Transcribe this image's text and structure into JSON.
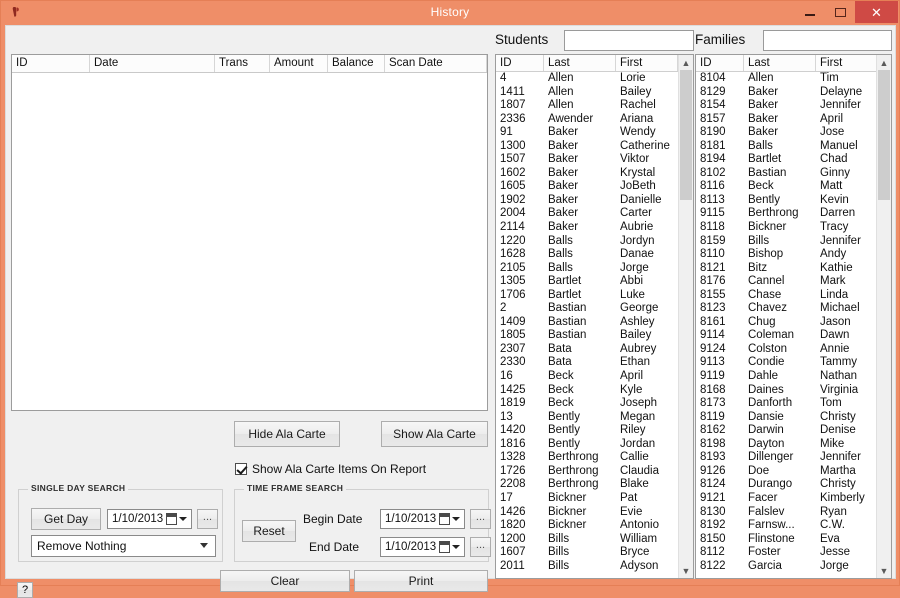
{
  "window": {
    "title": "History",
    "icon": "app-icon",
    "minimize_label": "–",
    "maximize_label": "□",
    "close_label": "✕",
    "border_color": "#ef8e68",
    "close_color": "#cf4a45"
  },
  "history_grid": {
    "columns": [
      "ID",
      "Date",
      "Trans",
      "Amount",
      "Balance",
      "Scan Date"
    ],
    "rows": []
  },
  "ala_carte": {
    "hide_label": "Hide Ala Carte",
    "show_label": "Show Ala Carte",
    "checkbox_label": "Show Ala Carte Items On Report",
    "checkbox_checked": true
  },
  "single_day_search": {
    "title": "SINGLE DAY SEARCH",
    "get_day_label": "Get Day",
    "date_value": "1/10/2013",
    "ellipsis_label": "...",
    "combo_value": "Remove Nothing"
  },
  "time_frame_search": {
    "title": "TIME FRAME SEARCH",
    "reset_label": "Reset",
    "begin_label": "Begin Date",
    "begin_value": "1/10/2013",
    "end_label": "End Date",
    "end_value": "1/10/2013",
    "ellipsis_label": "..."
  },
  "bottom_bar": {
    "clear_label": "Clear",
    "print_label": "Print",
    "help_label": "?"
  },
  "students": {
    "label": "Students",
    "search_value": "",
    "columns": [
      "ID",
      "Last",
      "First"
    ],
    "rows": [
      [
        "4",
        "Allen",
        "Lorie"
      ],
      [
        "1411",
        "Allen",
        "Bailey"
      ],
      [
        "1807",
        "Allen",
        "Rachel"
      ],
      [
        "2336",
        "Awender",
        "Ariana"
      ],
      [
        "91",
        "Baker",
        "Wendy"
      ],
      [
        "1300",
        "Baker",
        "Catherine"
      ],
      [
        "1507",
        "Baker",
        "Viktor"
      ],
      [
        "1602",
        "Baker",
        "Krystal"
      ],
      [
        "1605",
        "Baker",
        "JoBeth"
      ],
      [
        "1902",
        "Baker",
        "Danielle"
      ],
      [
        "2004",
        "Baker",
        "Carter"
      ],
      [
        "2114",
        "Baker",
        "Aubrie"
      ],
      [
        "1220",
        "Balls",
        "Jordyn"
      ],
      [
        "1628",
        "Balls",
        "Danae"
      ],
      [
        "2105",
        "Balls",
        "Jorge"
      ],
      [
        "1305",
        "Bartlet",
        "Abbi"
      ],
      [
        "1706",
        "Bartlet",
        "Luke"
      ],
      [
        "2",
        "Bastian",
        "George"
      ],
      [
        "1409",
        "Bastian",
        "Ashley"
      ],
      [
        "1805",
        "Bastian",
        "Bailey"
      ],
      [
        "2307",
        "Bata",
        "Aubrey"
      ],
      [
        "2330",
        "Bata",
        "Ethan"
      ],
      [
        "16",
        "Beck",
        "April"
      ],
      [
        "1425",
        "Beck",
        "Kyle"
      ],
      [
        "1819",
        "Beck",
        "Joseph"
      ],
      [
        "13",
        "Bently",
        "Megan"
      ],
      [
        "1420",
        "Bently",
        "Riley"
      ],
      [
        "1816",
        "Bently",
        "Jordan"
      ],
      [
        "1328",
        "Berthrong",
        "Callie"
      ],
      [
        "1726",
        "Berthrong",
        "Claudia"
      ],
      [
        "2208",
        "Berthrong",
        "Blake"
      ],
      [
        "17",
        "Bickner",
        "Pat"
      ],
      [
        "1426",
        "Bickner",
        "Evie"
      ],
      [
        "1820",
        "Bickner",
        "Antonio"
      ],
      [
        "1200",
        "Bills",
        "William"
      ],
      [
        "1607",
        "Bills",
        "Bryce"
      ],
      [
        "2011",
        "Bills",
        "Adyson"
      ]
    ]
  },
  "families": {
    "label": "Families",
    "search_value": "",
    "columns": [
      "ID",
      "Last",
      "First"
    ],
    "rows": [
      [
        "8104",
        "Allen",
        "Tim"
      ],
      [
        "8129",
        "Baker",
        "Delayne"
      ],
      [
        "8154",
        "Baker",
        "Jennifer"
      ],
      [
        "8157",
        "Baker",
        "April"
      ],
      [
        "8190",
        "Baker",
        "Jose"
      ],
      [
        "8181",
        "Balls",
        "Manuel"
      ],
      [
        "8194",
        "Bartlet",
        "Chad"
      ],
      [
        "8102",
        "Bastian",
        "Ginny"
      ],
      [
        "8116",
        "Beck",
        "Matt"
      ],
      [
        "8113",
        "Bently",
        "Kevin"
      ],
      [
        "9115",
        "Berthrong",
        "Darren"
      ],
      [
        "8118",
        "Bickner",
        "Tracy"
      ],
      [
        "8159",
        "Bills",
        "Jennifer"
      ],
      [
        "8110",
        "Bishop",
        "Andy"
      ],
      [
        "8121",
        "Bitz",
        "Kathie"
      ],
      [
        "8176",
        "Cannel",
        "Mark"
      ],
      [
        "8155",
        "Chase",
        "Linda"
      ],
      [
        "8123",
        "Chavez",
        "Michael"
      ],
      [
        "8161",
        "Chug",
        "Jason"
      ],
      [
        "9114",
        "Coleman",
        "Dawn"
      ],
      [
        "9124",
        "Colston",
        "Annie"
      ],
      [
        "9113",
        "Condie",
        "Tammy"
      ],
      [
        "9119",
        "Dahle",
        "Nathan"
      ],
      [
        "8168",
        "Daines",
        "Virginia"
      ],
      [
        "8173",
        "Danforth",
        "Tom"
      ],
      [
        "8119",
        "Dansie",
        "Christy"
      ],
      [
        "8162",
        "Darwin",
        "Denise"
      ],
      [
        "8198",
        "Dayton",
        "Mike"
      ],
      [
        "8193",
        "Dillenger",
        "Jennifer"
      ],
      [
        "9126",
        "Doe",
        "Martha"
      ],
      [
        "8124",
        "Durango",
        "Christy"
      ],
      [
        "9121",
        "Facer",
        "Kimberly"
      ],
      [
        "8130",
        "Falslev",
        "Ryan"
      ],
      [
        "8192",
        "Farnsw...",
        "C.W."
      ],
      [
        "8150",
        "Flinstone",
        "Eva"
      ],
      [
        "8112",
        "Foster",
        "Jesse"
      ],
      [
        "8122",
        "Garcia",
        "Jorge"
      ]
    ]
  },
  "scrollbar": {
    "up_arrow": "▲",
    "down_arrow": "▼"
  }
}
